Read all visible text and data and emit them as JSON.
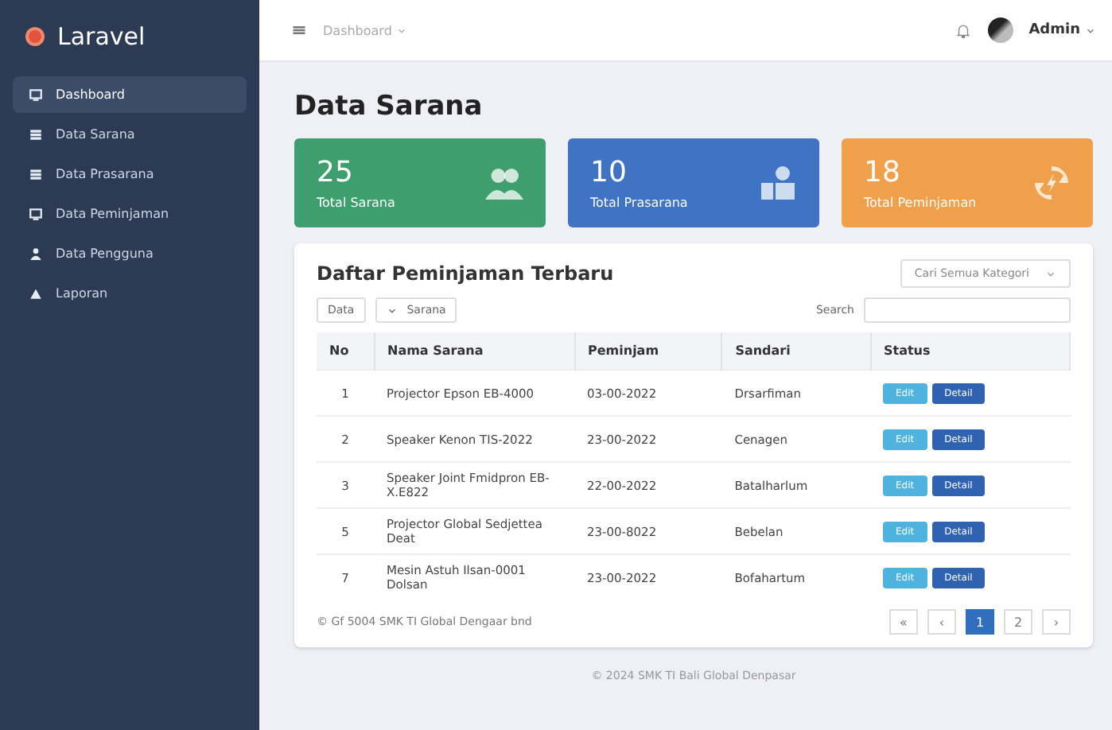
{
  "sidebar": {
    "brand": "Laravel",
    "items": [
      {
        "label": "Dashboard",
        "selected": true
      },
      {
        "label": "Data Sarana",
        "selected": false
      },
      {
        "label": "Data Prasarana",
        "selected": false
      },
      {
        "label": "Data Peminjaman",
        "selected": false
      },
      {
        "label": "Data Pengguna",
        "selected": false
      },
      {
        "label": "Laporan",
        "selected": false
      }
    ]
  },
  "topbar": {
    "breadcrumb": "Dashboard",
    "user": "Admin"
  },
  "page_title": "Data Sarana",
  "stats": [
    {
      "value": "25",
      "label": "Total Sarana",
      "color": "#3e9e6e"
    },
    {
      "value": "10",
      "label": "Total Prasarana",
      "color": "#3f73c4"
    },
    {
      "value": "18",
      "label": "Total Peminjaman",
      "color": "#f0a04b"
    }
  ],
  "panel": {
    "title": "Daftar Peminjaman Terbaru",
    "filter": "Cari Semua Kategori",
    "length_select": "Data",
    "length_label": "Sarana",
    "search_label": "Search",
    "columns": [
      "No",
      "Nama Sarana",
      "Peminjam",
      "Sandari",
      "Status"
    ],
    "rows": [
      {
        "cells": [
          "1",
          "Projector Epson EB-4000",
          "03-00-2022",
          "Drsarfiman"
        ],
        "actions": [
          "Edit",
          "Detail"
        ]
      },
      {
        "cells": [
          "2",
          "Speaker Kenon TIS-2022",
          "23-00-2022",
          "Cenagen"
        ],
        "actions": [
          "Edit",
          "Detail"
        ]
      },
      {
        "cells": [
          "3",
          "Speaker Joint Fmidpron EB-X.E822",
          "22-00-2022",
          "Batalharlum"
        ],
        "actions": [
          "Edit",
          "Detail"
        ]
      },
      {
        "cells": [
          "5",
          "Projector Global Sedjettea Deat",
          "23-00-8022",
          "Bebelan"
        ],
        "actions": [
          "Edit",
          "Detail"
        ]
      },
      {
        "cells": [
          "7",
          "Mesin Astuh Ilsan-0001 Dolsan",
          "23-00-2022",
          "Bofahartum"
        ],
        "actions": [
          "Edit",
          "Detail"
        ]
      }
    ],
    "info": "© Gf 5004 SMK TI Global Dengaar bnd",
    "pages": [
      {
        "label": "«",
        "selected": false
      },
      {
        "label": "‹",
        "selected": false
      },
      {
        "label": "1",
        "selected": true
      },
      {
        "label": "2",
        "selected": false
      },
      {
        "label": "›",
        "selected": false
      }
    ]
  },
  "footer": "© 2024 SMK TI Bali Global Denpasar"
}
